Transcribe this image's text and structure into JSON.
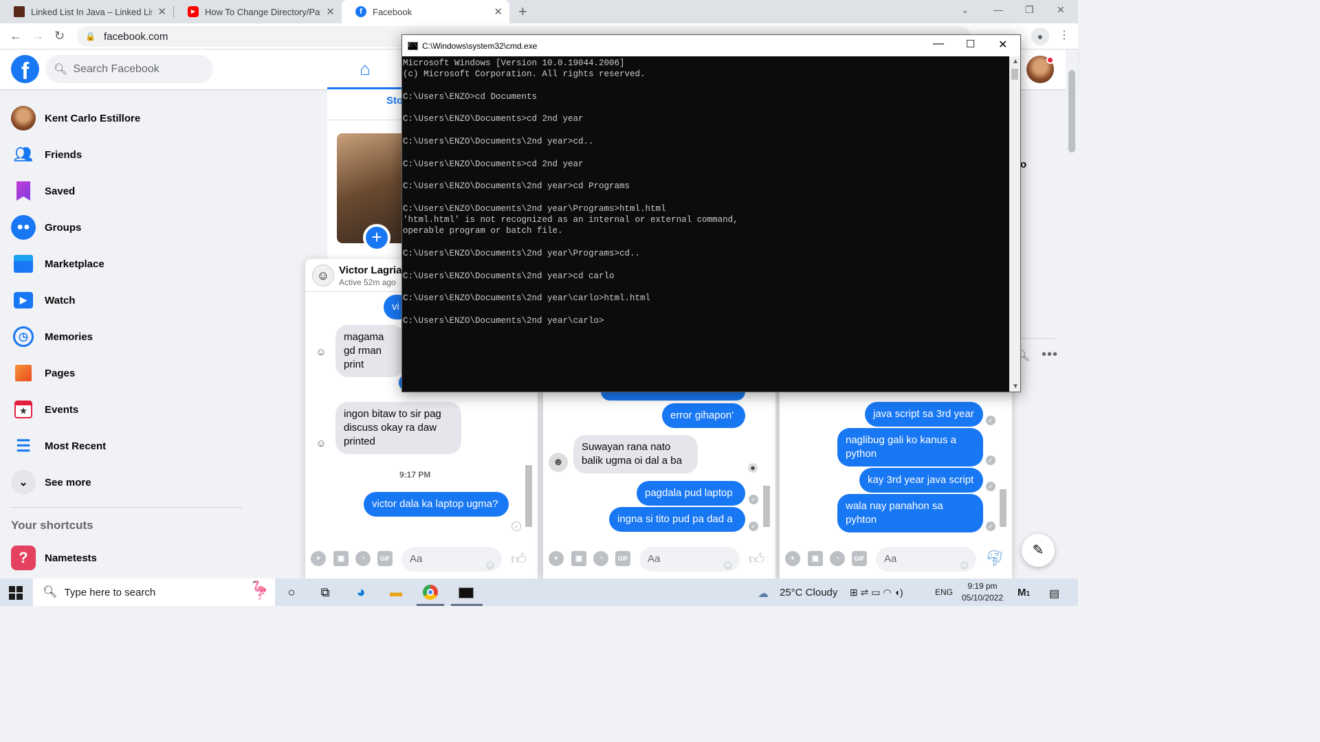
{
  "browser": {
    "tabs": [
      {
        "title": "Linked List In Java – Linked List In",
        "icon": "linked-list-favicon"
      },
      {
        "title": "How To Change Directory/Path in",
        "icon": "youtube-favicon"
      },
      {
        "title": "Facebook",
        "icon": "facebook-favicon"
      }
    ],
    "url": "facebook.com"
  },
  "facebook": {
    "search_placeholder": "Search Facebook",
    "stories_tab": "Sto",
    "right_fragment": "o",
    "nav": [
      {
        "label": "Kent Carlo Estillore",
        "icon": "profile-avatar"
      },
      {
        "label": "Friends",
        "icon": "friends-icon"
      },
      {
        "label": "Saved",
        "icon": "saved-icon"
      },
      {
        "label": "Groups",
        "icon": "groups-icon"
      },
      {
        "label": "Marketplace",
        "icon": "marketplace-icon"
      },
      {
        "label": "Watch",
        "icon": "watch-icon"
      },
      {
        "label": "Memories",
        "icon": "memories-icon"
      },
      {
        "label": "Pages",
        "icon": "pages-icon"
      },
      {
        "label": "Events",
        "icon": "events-icon"
      },
      {
        "label": "Most Recent",
        "icon": "most-recent-icon"
      },
      {
        "label": "See more",
        "icon": "chevron-down-icon"
      }
    ],
    "shortcuts_title": "Your shortcuts",
    "shortcuts": [
      {
        "label": "Nametests",
        "icon": "nametests-icon"
      }
    ],
    "accent": "#1877f2"
  },
  "chats": [
    {
      "name": "Victor Lagria",
      "status": "Active 52m ago",
      "messages": [
        {
          "dir": "out",
          "text": "vi"
        },
        {
          "dir": "in",
          "text": "magama gd rman print"
        },
        {
          "dir": "in",
          "text": "ingon bitaw to sir pag discuss okay ra daw printed"
        },
        {
          "dir": "out",
          "text": "victor dala ka laptop ugma?"
        }
      ],
      "timestamp": "9:17 PM",
      "input_placeholder": "Aa"
    },
    {
      "name": "",
      "status": "",
      "messages": [
        {
          "dir": "out",
          "text": "error gihapon'"
        },
        {
          "dir": "in",
          "text": "Suwayan rana nato balik ugma oi dal a ba"
        },
        {
          "dir": "out",
          "text": "pagdala pud laptop"
        },
        {
          "dir": "out",
          "text": "ingna si tito pud pa dad a"
        }
      ],
      "input_placeholder": "Aa"
    },
    {
      "name": "",
      "status": "",
      "messages": [
        {
          "dir": "out",
          "text": "java script sa 3rd year"
        },
        {
          "dir": "out",
          "text": "naglibug gali ko kanus a python"
        },
        {
          "dir": "out",
          "text": "kay 3rd year java script"
        },
        {
          "dir": "out",
          "text": "wala nay panahon sa pyhton"
        }
      ],
      "input_placeholder": "Aa"
    }
  ],
  "cmd": {
    "title": "C:\\Windows\\system32\\cmd.exe",
    "lines": [
      "Microsoft Windows [Version 10.0.19044.2006]",
      "(c) Microsoft Corporation. All rights reserved.",
      "",
      "C:\\Users\\ENZO>cd Documents",
      "",
      "C:\\Users\\ENZO\\Documents>cd 2nd year",
      "",
      "C:\\Users\\ENZO\\Documents\\2nd year>cd..",
      "",
      "C:\\Users\\ENZO\\Documents>cd 2nd year",
      "",
      "C:\\Users\\ENZO\\Documents\\2nd year>cd Programs",
      "",
      "C:\\Users\\ENZO\\Documents\\2nd year\\Programs>html.html",
      "'html.html' is not recognized as an internal or external command,",
      "operable program or batch file.",
      "",
      "C:\\Users\\ENZO\\Documents\\2nd year\\Programs>cd..",
      "",
      "C:\\Users\\ENZO\\Documents\\2nd year>cd carlo",
      "",
      "C:\\Users\\ENZO\\Documents\\2nd year\\carlo>html.html",
      "",
      "C:\\Users\\ENZO\\Documents\\2nd year\\carlo>"
    ]
  },
  "taskbar": {
    "search_placeholder": "Type here to search",
    "weather": "25°C  Cloudy",
    "language": "ENG",
    "time": "9:19 pm",
    "date": "05/10/2022",
    "notification_count": "1"
  }
}
